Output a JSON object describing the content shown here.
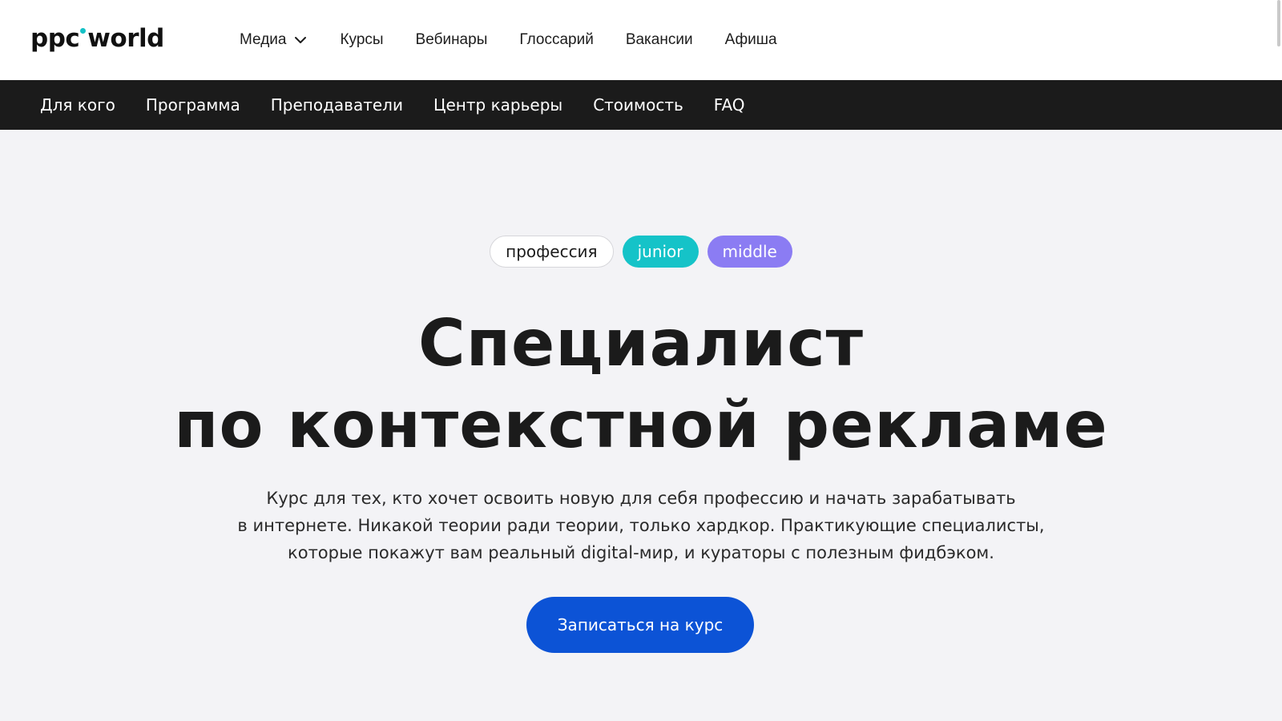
{
  "header": {
    "logo_left": "ppc",
    "logo_right": "world",
    "nav": [
      {
        "label": "Медиа",
        "has_dropdown": true
      },
      {
        "label": "Курсы"
      },
      {
        "label": "Вебинары"
      },
      {
        "label": "Глоссарий"
      },
      {
        "label": "Вакансии"
      },
      {
        "label": "Афиша"
      }
    ]
  },
  "section_nav": [
    "Для кого",
    "Программа",
    "Преподаватели",
    "Центр карьеры",
    "Стоимость",
    "FAQ"
  ],
  "hero": {
    "tags": [
      {
        "label": "профессия",
        "style": "outline"
      },
      {
        "label": "junior",
        "color": "#15c3c8"
      },
      {
        "label": "middle",
        "color": "#8b7cf3"
      }
    ],
    "title_lines": [
      "Специалист",
      "по контекстной рекламе"
    ],
    "description_lines": [
      "Курс для тех, кто хочет освоить новую для себя профессию и начать зарабатывать",
      "в интернете. Никакой теории ради теории, только хардкор. Практикующие специалисты,",
      "которые покажут вам реальный digital-мир, и кураторы с полезным фидбэком."
    ],
    "cta_label": "Записаться на курс"
  },
  "colors": {
    "accent": "#0c53d6",
    "logo_dot": "#14c1c6",
    "dark_nav": "#1b1b1b",
    "background": "#f3f3f6"
  },
  "icons": {
    "dropdown": "chevron-down-icon"
  }
}
